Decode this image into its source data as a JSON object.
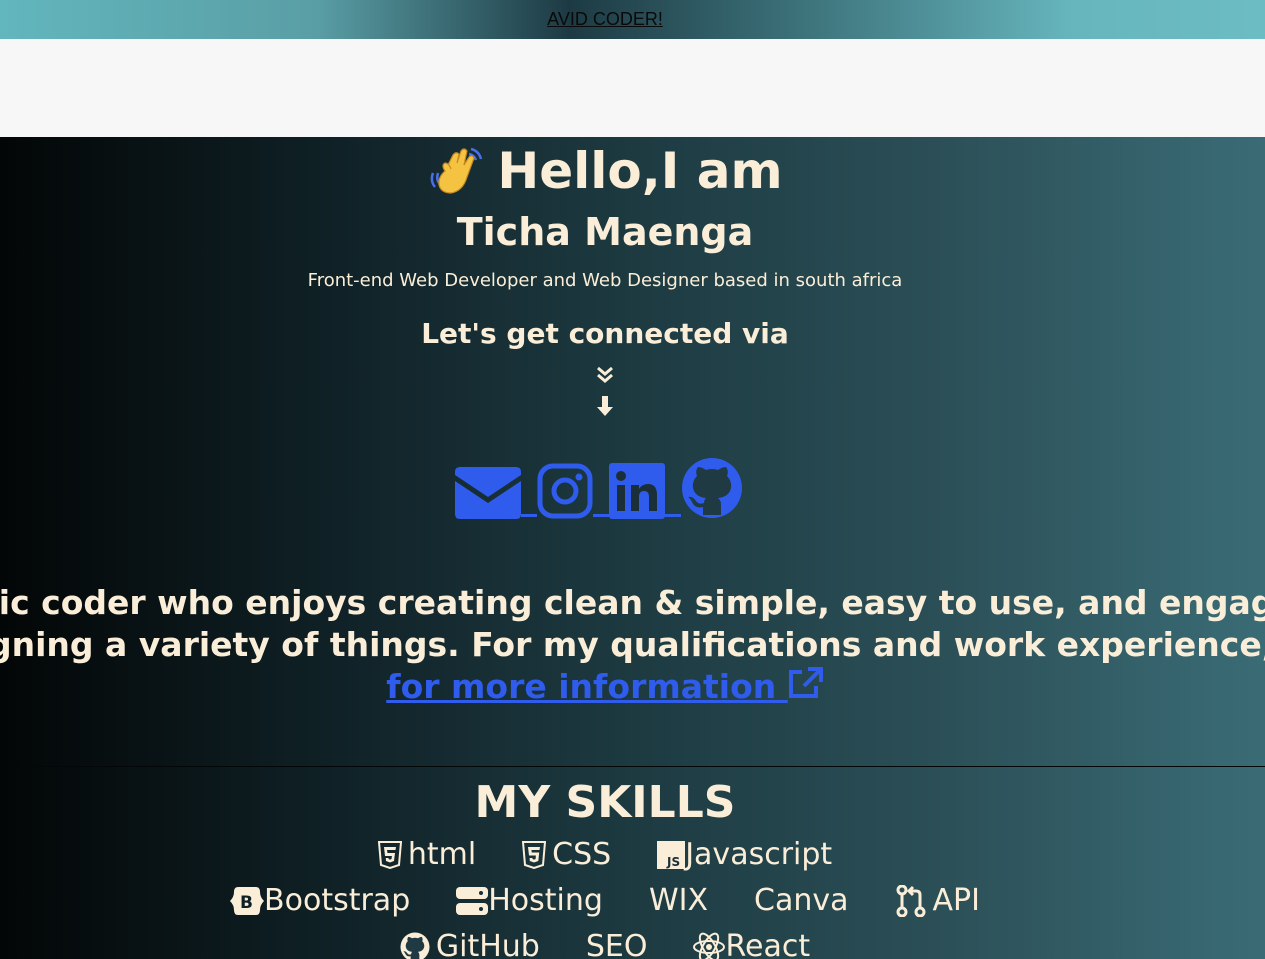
{
  "top_banner": {
    "link_text": "AVID CODER!"
  },
  "hero": {
    "greeting": "Hello,I am",
    "name": "Ticha Maenga",
    "subtitle": "Front-end Web Developer and Web Designer based in south africa",
    "connect_heading": "Let's get connected via",
    "socials": [
      {
        "icon": "envelope-icon"
      },
      {
        "icon": "instagram-icon"
      },
      {
        "icon": "linkedin-icon"
      },
      {
        "icon": "github-icon"
      }
    ],
    "bio_line1": "tic coder who enjoys creating clean & simple, easy to use, and engaging user int",
    "bio_line2": "gning a variety of things. For my qualifications and work experience, follow this l",
    "more_info_link": "for more information "
  },
  "skills": {
    "title": "MY SKILLS",
    "row1": [
      "html",
      "CSS",
      "Javascript"
    ],
    "row2": [
      "Bootstrap",
      "Hosting",
      "WIX",
      "Canva",
      "API"
    ],
    "row3": [
      "GitHub",
      "SEO",
      "React"
    ]
  },
  "colors": {
    "text": "#fbeed8",
    "link": "#2f5cec",
    "banner_left": "#62b6bd",
    "banner_mid": "#1d3a44",
    "hero_dark": "#030606",
    "hero_light": "#3a6c76"
  }
}
